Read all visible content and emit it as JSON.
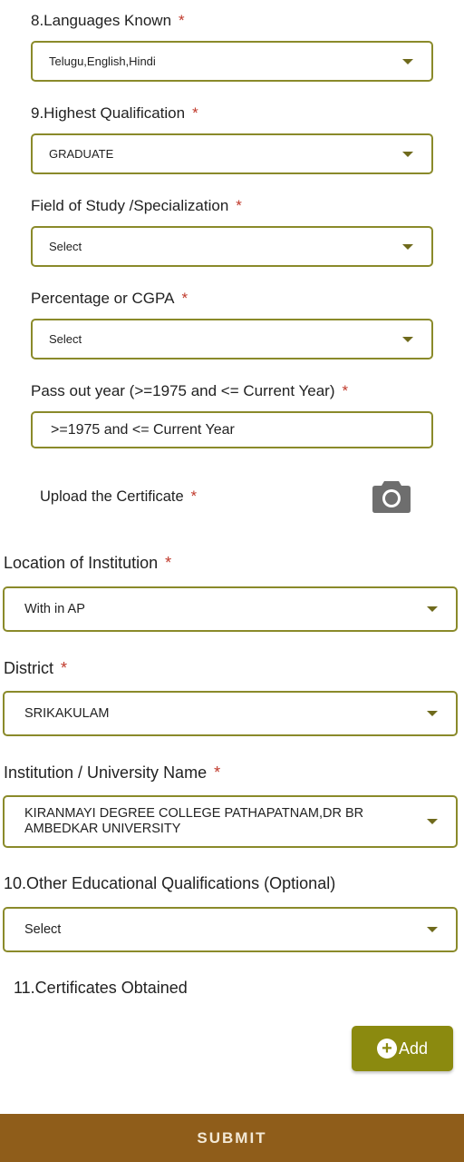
{
  "languages": {
    "label": "8.Languages Known",
    "required": "*",
    "value": "Telugu,English,Hindi"
  },
  "qualification": {
    "label": "9.Highest Qualification",
    "required": "*",
    "value": "GRADUATE"
  },
  "field_of_study": {
    "label": "Field of Study /Specialization",
    "required": "*",
    "value": "Select"
  },
  "percentage": {
    "label": "Percentage or CGPA",
    "required": "*",
    "value": "Select"
  },
  "pass_out_year": {
    "label": "Pass out year (>=1975 and <= Current Year)",
    "required": "*",
    "placeholder": ">=1975 and <= Current Year"
  },
  "upload_certificate": {
    "label": "Upload the Certificate",
    "required": "*",
    "icon": "camera-icon"
  },
  "location": {
    "label": "Location of Institution",
    "required": "*",
    "value": "With in AP"
  },
  "district": {
    "label": "District",
    "required": "*",
    "value": "SRIKAKULAM"
  },
  "institution": {
    "label": "Institution / University Name",
    "required": "*",
    "value_line1": "KIRANMAYI DEGREE COLLEGE PATHAPATNAM,DR BR",
    "value_line2": "AMBEDKAR UNIVERSITY"
  },
  "other_qualifications": {
    "label": "10.Other Educational Qualifications (Optional)",
    "value": "Select"
  },
  "certificates": {
    "label": "11.Certificates Obtained",
    "add_label": "Add",
    "add_icon": "plus-circle-icon"
  },
  "submit_label": "SUBMIT",
  "colors": {
    "border": "#8a8a2a",
    "add_button": "#8b8a0f",
    "submit_bar": "#8f5d1a",
    "required": "#c0392b"
  }
}
